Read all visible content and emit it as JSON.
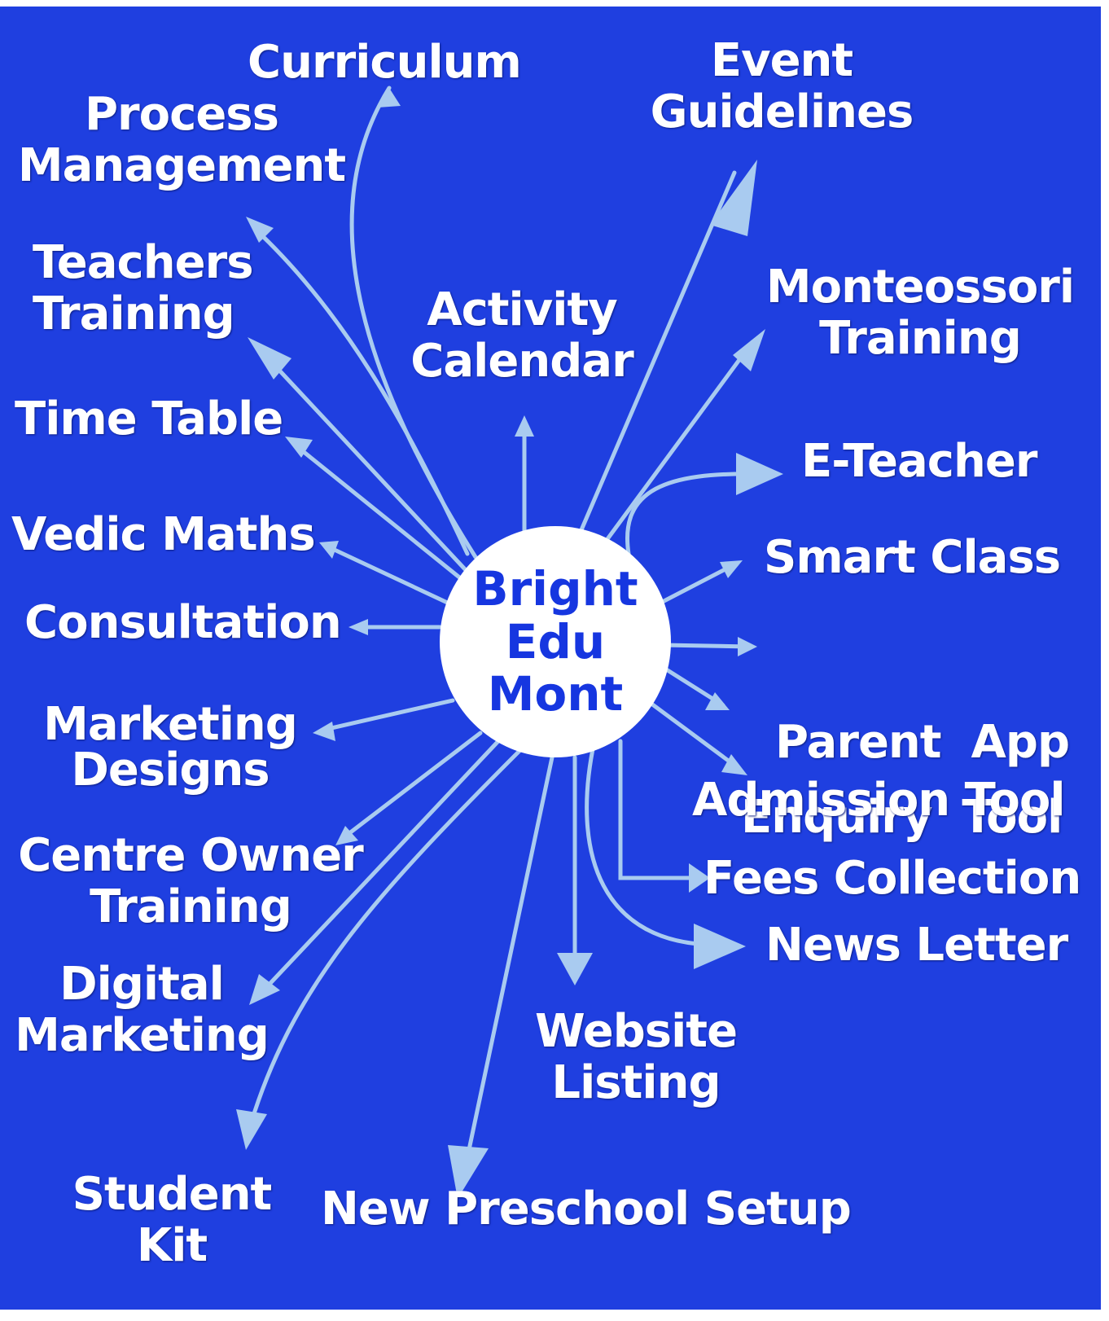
{
  "center": {
    "lines": [
      "Bright",
      "Edu",
      "Mont"
    ]
  },
  "colors": {
    "background": "#1f3fe0",
    "arrow": "#a9cbf0",
    "center_text": "#1636e0",
    "label": "#ffffff"
  },
  "nodes": [
    {
      "id": "curriculum",
      "lines": [
        "Curriculum"
      ]
    },
    {
      "id": "process-management",
      "lines": [
        "Process",
        "Management"
      ]
    },
    {
      "id": "event-guidelines",
      "lines": [
        "Event",
        "Guidelines"
      ]
    },
    {
      "id": "teachers-training",
      "lines": [
        "Teachers",
        "Training"
      ]
    },
    {
      "id": "activity-calendar",
      "lines": [
        "Activity",
        "Calendar"
      ]
    },
    {
      "id": "monteossori-training",
      "lines": [
        "Monteossori",
        "Training"
      ]
    },
    {
      "id": "time-table",
      "lines": [
        "Time Table"
      ]
    },
    {
      "id": "e-teacher",
      "lines": [
        "E-Teacher"
      ]
    },
    {
      "id": "vedic-maths",
      "lines": [
        "Vedic Maths"
      ]
    },
    {
      "id": "smart-class",
      "lines": [
        "Smart Class"
      ]
    },
    {
      "id": "consultation",
      "lines": [
        "Consultation"
      ]
    },
    {
      "id": "parent-app",
      "lines": [
        "Parent  App"
      ]
    },
    {
      "id": "enquiry-tool",
      "lines": [
        "Enquiry  Tool"
      ]
    },
    {
      "id": "marketing-designs",
      "lines": [
        "Marketing",
        "Designs"
      ]
    },
    {
      "id": "admission-tool",
      "lines": [
        "Admission Tool"
      ]
    },
    {
      "id": "centre-owner-training",
      "lines": [
        "Centre Owner",
        "Training"
      ]
    },
    {
      "id": "fees-collection",
      "lines": [
        "Fees Collection"
      ]
    },
    {
      "id": "news-letter",
      "lines": [
        "News Letter"
      ]
    },
    {
      "id": "digital-marketing",
      "lines": [
        "Digital",
        "Marketing"
      ]
    },
    {
      "id": "website-listing",
      "lines": [
        "Website",
        "Listing"
      ]
    },
    {
      "id": "student-kit",
      "lines": [
        "Student",
        "Kit"
      ]
    },
    {
      "id": "new-preschool-setup",
      "lines": [
        "New Preschool Setup"
      ]
    }
  ]
}
